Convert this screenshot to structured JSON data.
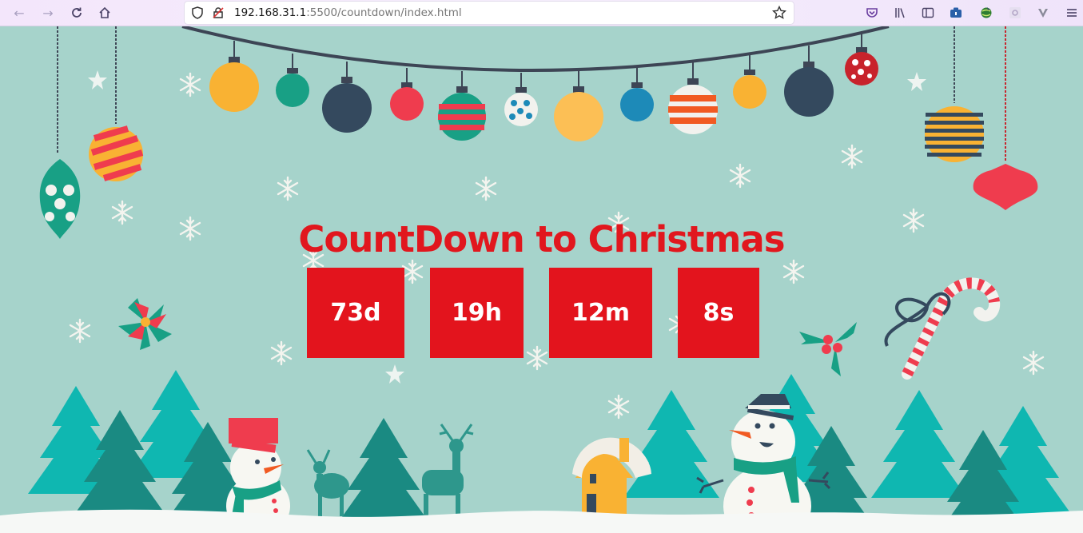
{
  "browser": {
    "url_host": "192.168.31.1",
    "url_rest": ":5500/countdown/index.html",
    "icons": [
      "back-icon",
      "forward-icon",
      "reload-icon",
      "home-icon",
      "shield-icon",
      "insecure-lock-icon",
      "bookmark-star-icon",
      "pocket-icon",
      "library-icon",
      "sidebar-icon",
      "extension-icon",
      "extension-globe-icon",
      "extension-gear-icon",
      "extension-v-icon",
      "menu-icon"
    ]
  },
  "countdown": {
    "title": "CountDown to Christmas",
    "days": "73d",
    "hours": "19h",
    "minutes": "12m",
    "seconds": "8s"
  },
  "colors": {
    "background": "#a6d3cb",
    "title": "#e1171e",
    "box": "#e3141d",
    "box_text": "#ffffff"
  }
}
